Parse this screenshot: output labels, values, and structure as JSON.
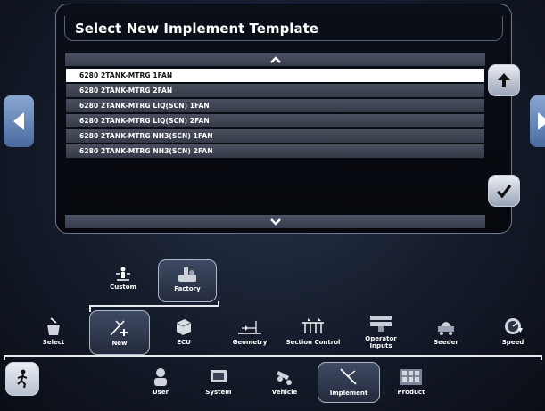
{
  "dialog": {
    "title": "Select New Implement Template",
    "items": [
      "6280 2TANK-MTRG 1FAN",
      "6280 2TANK-MTRG 2FAN",
      "6280 2TANK-MTRG LIQ(SCN) 1FAN",
      "6280 2TANK-MTRG LIQ(SCN) 2FAN",
      "6280 2TANK-MTRG NH3(SCN) 1FAN",
      "6280 2TANK-MTRG NH3(SCN) 2FAN"
    ],
    "selected_index": 0
  },
  "setup_mode": {
    "custom": "Custom",
    "factory": "Factory"
  },
  "implement_menu": {
    "select": "Select",
    "new": "New",
    "ecu": "ECU",
    "geometry": "Geometry",
    "section_control": "Section Control",
    "operator_inputs": "Operator Inputs",
    "seeder": "Seeder",
    "speed": "Speed"
  },
  "main_menu": {
    "user": "User",
    "system": "System",
    "vehicle": "Vehicle",
    "implement": "Implement",
    "product": "Product"
  },
  "colors": {
    "accent": "#4a6aa0",
    "selected_row": "#ffffff",
    "row": "#40465a"
  }
}
